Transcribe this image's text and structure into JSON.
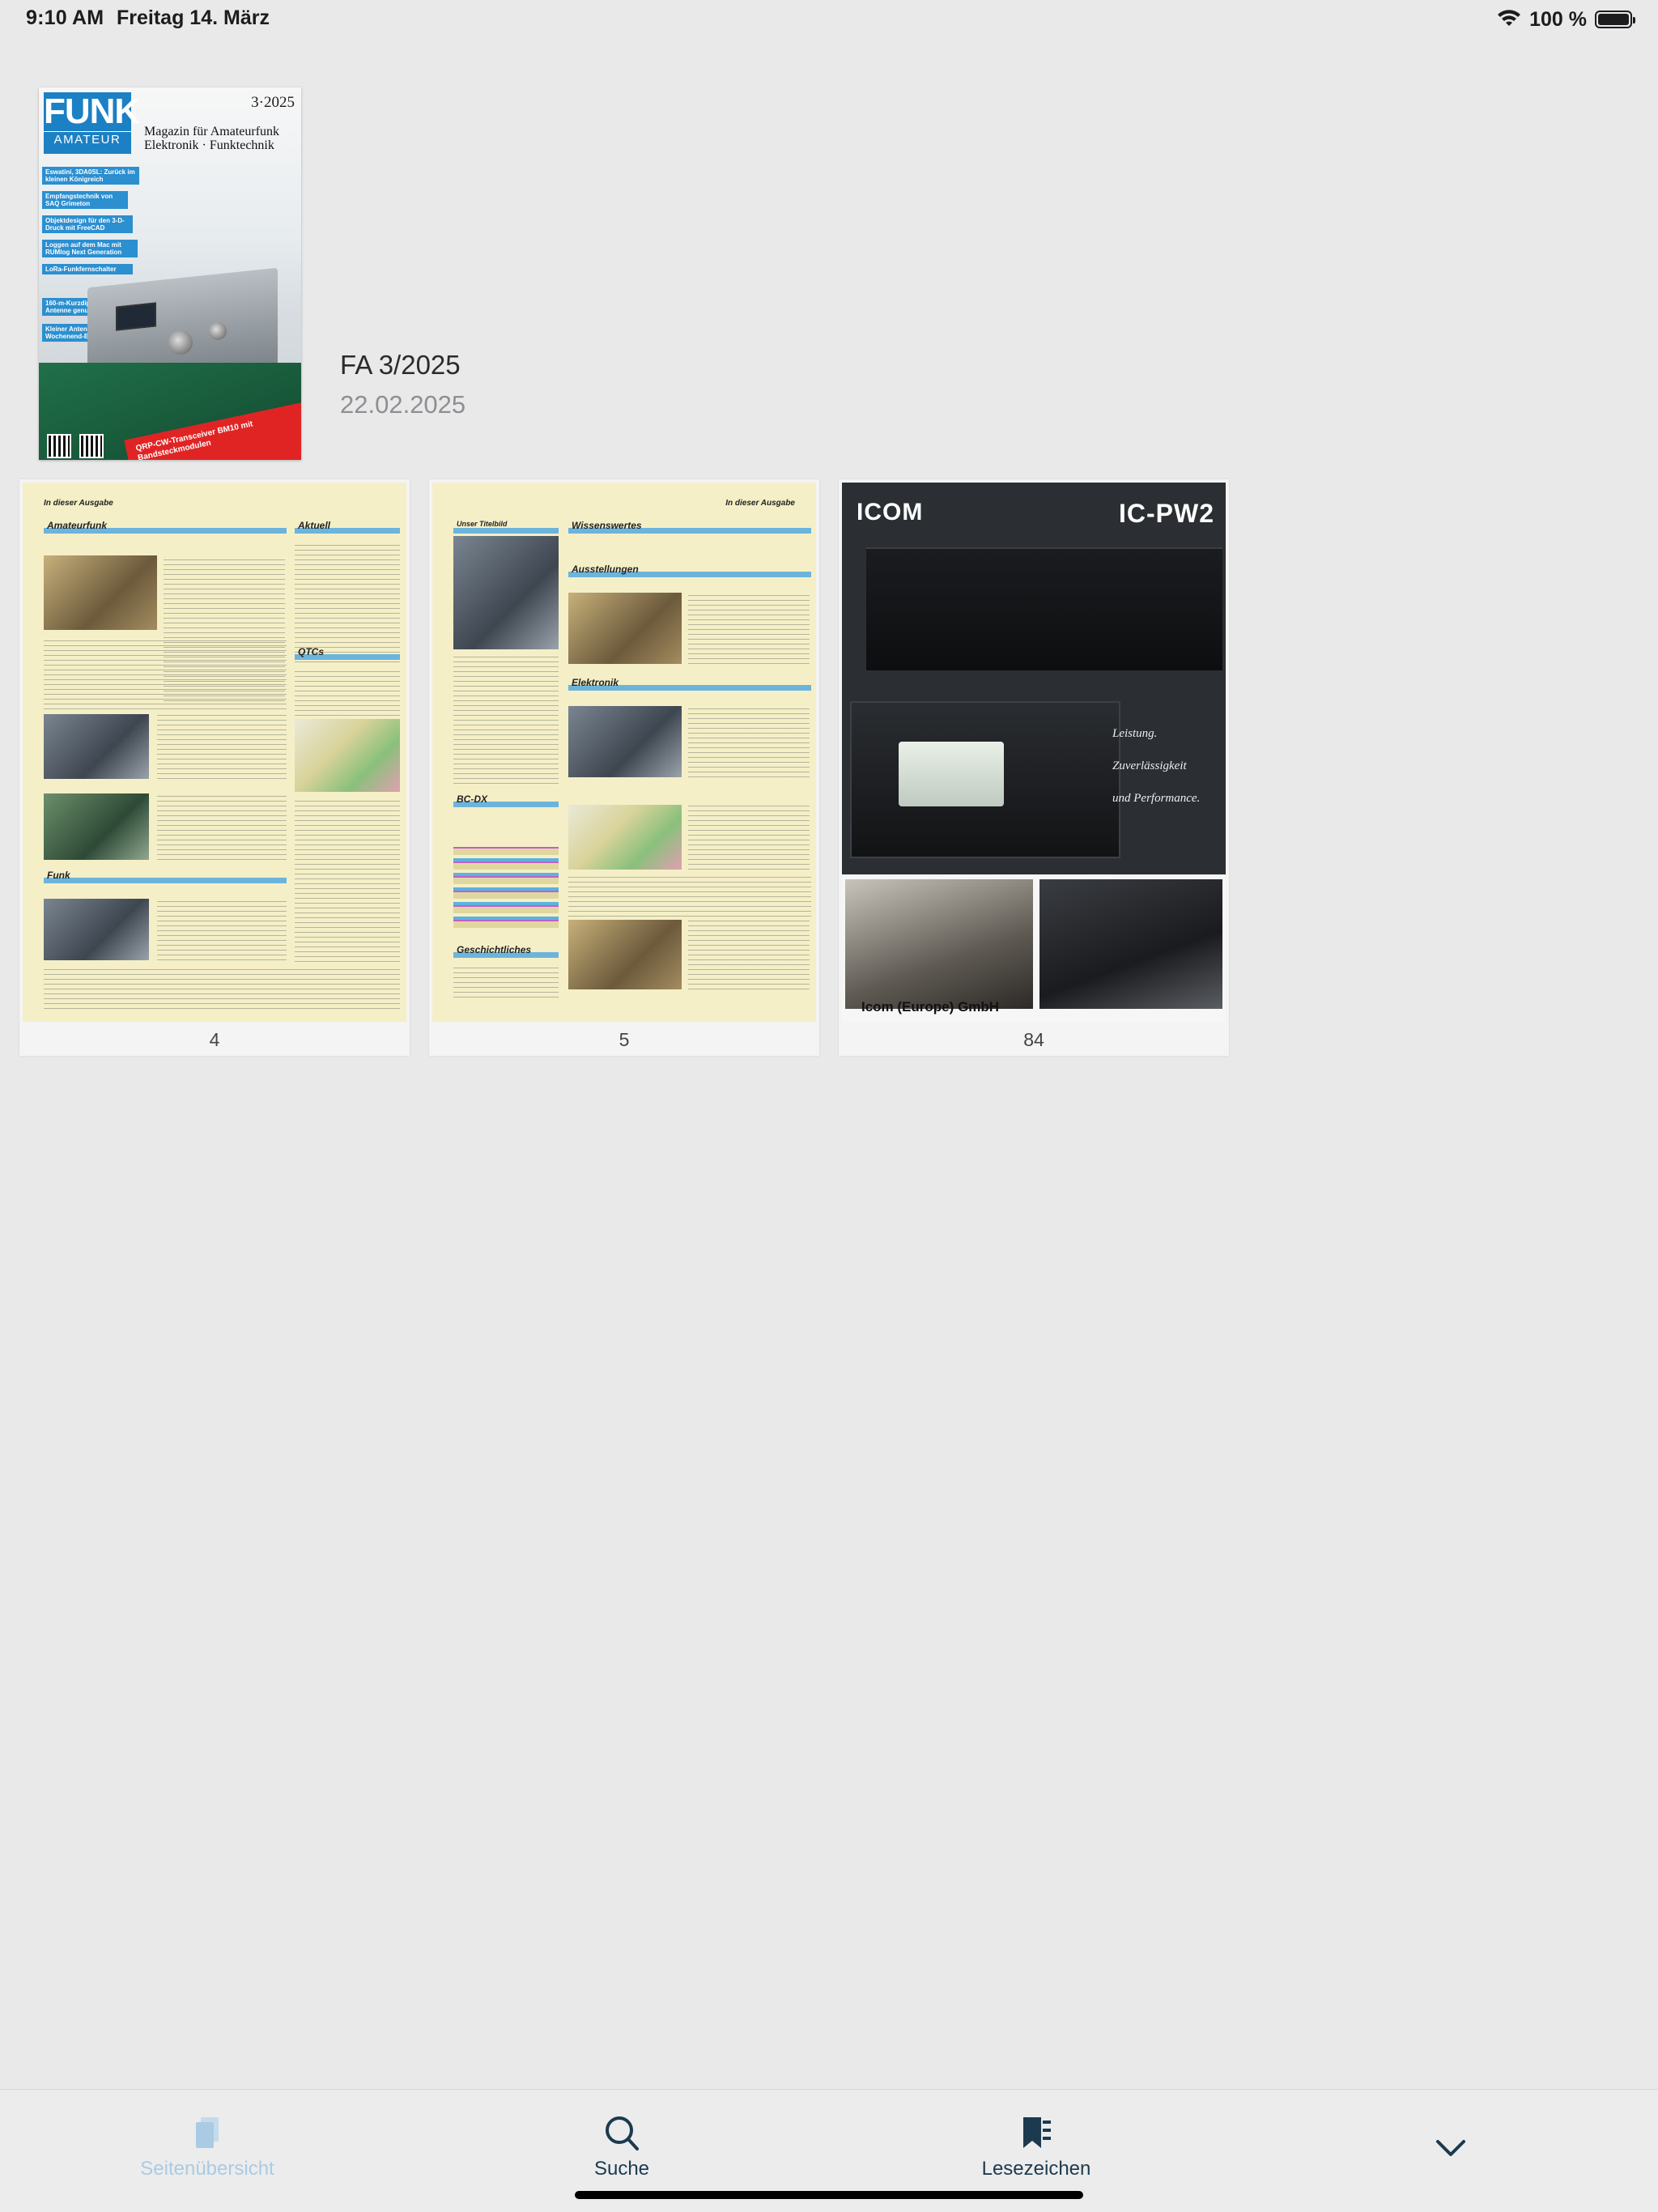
{
  "status_bar": {
    "time": "9:10 AM",
    "date": "Freitag 14. März",
    "battery": "100 %"
  },
  "issue": {
    "title": "FA 3/2025",
    "date": "22.02.2025",
    "cover": {
      "logo_top": "FUNK",
      "logo_bottom": "AMATEUR",
      "issue_number": "3·2025",
      "tagline_1": "Magazin für Amateurfunk",
      "tagline_2": "Elektronik · Funktechnik",
      "headlines": [
        "Eswatini, 3DA0SL: Zurück im kleinen Königreich",
        "Empfangstechnik von SAQ Grimeton",
        "Objektdesign für den 3-D-Druck mit FreeCAD",
        "Loggen auf dem Mac mit RUMlog Next Generation",
        "LoRa-Funkfernschalter",
        "160-m-Kurzdipol als T-Antenne genutzt",
        "Kleiner Antennenrotor als Wochenend-Bastelprojekt"
      ],
      "banner": "QRP-CW-Transceiver BM10 mit Bandsteckmodulen"
    }
  },
  "pages": [
    {
      "number": "4",
      "header": "In dieser Ausgabe",
      "sections": [
        "Amateurfunk",
        "Aktuell",
        "QTCs",
        "Funk"
      ]
    },
    {
      "number": "5",
      "header": "In dieser Ausgabe",
      "sections": [
        "Unser Titelbild",
        "Wissenswertes",
        "Ausstellungen",
        "Elektronik",
        "BC-DX",
        "Geschichtliches"
      ]
    },
    {
      "number": "84",
      "ad_brand": "ICOM",
      "ad_model": "IC-PW2",
      "ad_slogan": [
        "Leistung.",
        "Zuverlässigkeit",
        "und Performance."
      ],
      "ad_company": "Icom (Europe) GmbH"
    }
  ],
  "tab_bar": {
    "tabs": [
      {
        "label": "Seitenübersicht",
        "icon": "pages-icon",
        "active": true
      },
      {
        "label": "Suche",
        "icon": "search-icon",
        "active": false
      },
      {
        "label": "Lesezeichen",
        "icon": "bookmark-icon",
        "active": false
      }
    ],
    "collapse_icon": "chevron-down-icon"
  },
  "colors": {
    "background": "#e9e9e9",
    "active_tab": "#a9cbe3",
    "tab_text": "#1c3a4f",
    "toc_accent": "#6cb4dc"
  }
}
